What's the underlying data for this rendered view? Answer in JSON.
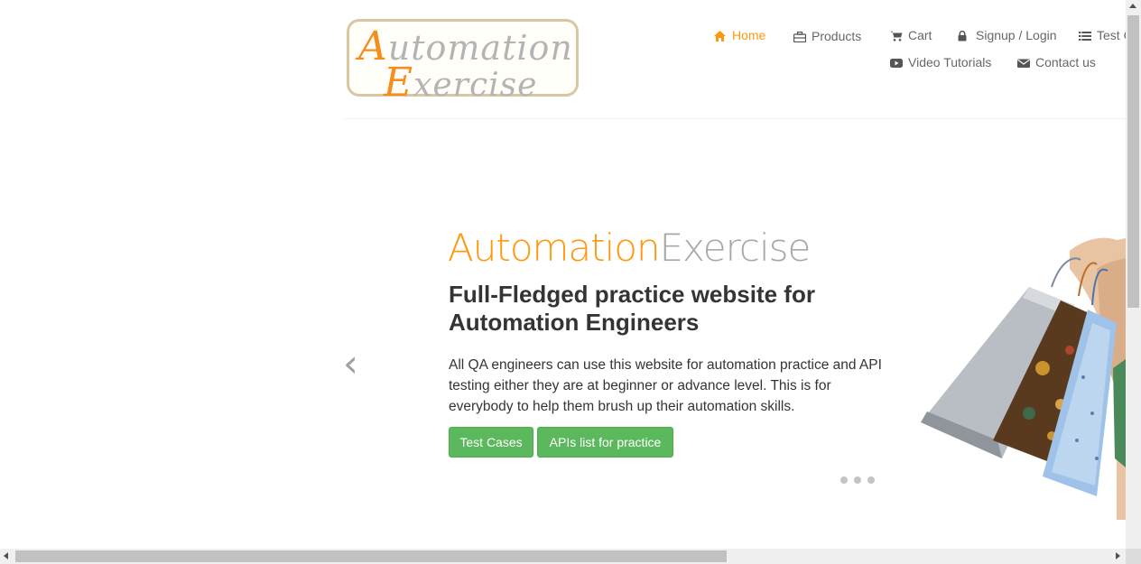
{
  "logo": {
    "line1_cap": "A",
    "line1_rest": "utomation",
    "line2_cap": "E",
    "line2_rest": "xercise"
  },
  "nav": {
    "items": [
      {
        "label": "Home",
        "icon": "home-icon",
        "active": true
      },
      {
        "label": "Products",
        "icon": "briefcase-icon"
      },
      {
        "label": "Cart",
        "icon": "shopping-cart-icon"
      },
      {
        "label": "Signup / Login",
        "icon": "lock-icon"
      },
      {
        "label": "Test C",
        "icon": "list-icon"
      },
      {
        "label": "Video Tutorials",
        "icon": "youtube-play-icon"
      },
      {
        "label": "Contact us",
        "icon": "envelope-icon"
      }
    ]
  },
  "slider": {
    "brand_orange": "Automation",
    "brand_grey": "Exercise",
    "headline": "Full-Fledged practice website for Automation Engineers",
    "description": "All QA engineers can use this website for automation practice and API testing either they are at beginner or advance level. This is for everybody to help them brush up their automation skills.",
    "btn_test_cases": "Test Cases",
    "btn_apis": "APIs list for practice",
    "prev_arrow": "‹",
    "dot_count": 3
  },
  "colors": {
    "accent": "#fe980f",
    "button": "#5cb85c",
    "text_dark": "#363432",
    "nav_text": "#696763"
  }
}
